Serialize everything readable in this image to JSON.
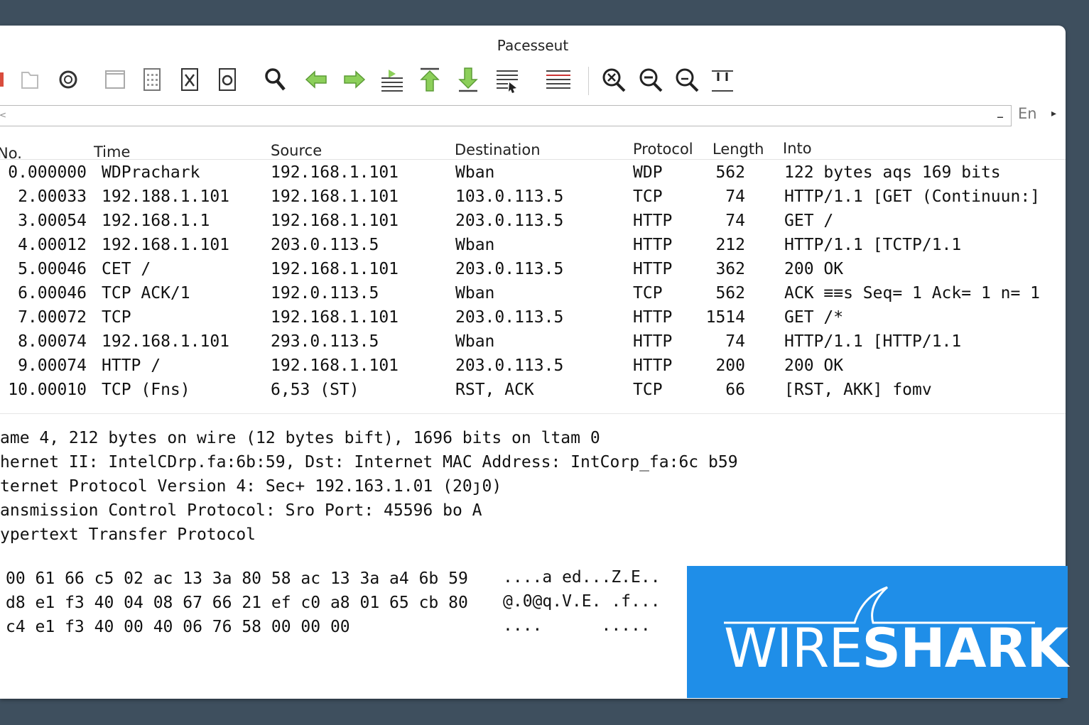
{
  "window": {
    "title": "Pacesseut"
  },
  "toolbar": {
    "icons": [
      "stop-capture-icon",
      "open-file-icon",
      "restart-icon",
      "blank-page-icon",
      "file-set-icon",
      "close-file-icon",
      "reload-icon",
      "find-icon",
      "go-back-icon",
      "go-forward-icon",
      "go-to-packet-icon",
      "go-first-icon",
      "go-last-icon",
      "autoscroll-icon",
      "colorize-icon",
      "zoom-in-icon",
      "zoom-out-icon",
      "normal-size-icon",
      "resize-columns-icon"
    ]
  },
  "filter": {
    "value": "",
    "apply_label": "En",
    "lt_glyph": "<",
    "clear_glyph": "–",
    "more_glyph": "▸"
  },
  "columns": {
    "no": "No.",
    "time": "Time",
    "source": "Source",
    "destination": "Destination",
    "protocol": "Protocol",
    "length": "Length",
    "info": "Into"
  },
  "packets": [
    {
      "no": "0.000000",
      "time": "WDPrachark",
      "source": "192.168.1.101",
      "destination": "Wban",
      "protocol": "WDP",
      "length": "562",
      "info": "122 bytes aqs 169 bits"
    },
    {
      "no": "2.00033",
      "time": "192.188.1.101",
      "source": "192.168.1.101",
      "destination": "103.0.113.5",
      "protocol": "TCP",
      "length": "74",
      "info": "HTTP/1.1 [GET (Continuun:]"
    },
    {
      "no": "3.00054",
      "time": "192.168.1.1",
      "source": "192.168.1.101",
      "destination": "203.0.113.5",
      "protocol": "HTTP",
      "length": "74",
      "info": "GET /"
    },
    {
      "no": "4.00012",
      "time": "192.168.1.101",
      "source": "203.0.113.5",
      "destination": "Wban",
      "protocol": "HTTP",
      "length": "212",
      "info": "HTTP/1.1 [TCTP/1.1"
    },
    {
      "no": "5.00046",
      "time": "CET  /",
      "source": "192.168.1.101",
      "destination": "203.0.113.5",
      "protocol": "HTTP",
      "length": "362",
      "info": "200 OK"
    },
    {
      "no": "6.00046",
      "time": "TCP ACK/1",
      "source": "192.0.113.5",
      "destination": "Wban",
      "protocol": "TCP",
      "length": "562",
      "info": "ACK ≡≡s Seq= 1 Ack= 1 n= 1"
    },
    {
      "no": "7.00072",
      "time": "TCP",
      "source": "192.168.1.101",
      "destination": "203.0.113.5",
      "protocol": "HTTP",
      "length": "1514",
      "info": "GET /*"
    },
    {
      "no": "8.00074",
      "time": "192.168.1.101",
      "source": "293.0.113.5",
      "destination": "Wban",
      "protocol": "HTTP",
      "length": "74",
      "info": "HTTP/1.1 [HTTP/1.1"
    },
    {
      "no": "9.00074",
      "time": "HTTP /",
      "source": "192.168.1.101",
      "destination": "203.0.113.5",
      "protocol": "HTTP",
      "length": "200",
      "info": "200 OK"
    },
    {
      "no": "10.00010",
      "time": "TCP (Fns)",
      "source": "6,53 (ST)",
      "destination": "RST, ACK",
      "protocol": "TCP",
      "length": "66",
      "info": "[RST, AKK] fomv"
    }
  ],
  "details": [
    "ame 4, 212 bytes on wire (12 bytes bift), 1696 bits on ltam 0",
    "hernet II: IntelCDrp.fa:6b:59, Dst: Internet MAC Address: IntCorp_fa:6c b59",
    "ternet Protocol Version 4: Sec+ 192.163.1.01 (20ȷ0)",
    "ansmission Control Protocol: Sro Port: 45596 bo A",
    "ypertext Transfer Protocol"
  ],
  "bytes": {
    "hex": [
      "00 61 66 c5 02 ac 13 3a 80 58 ac 13 3a a4 6b 59",
      "d8 e1 f3 40 04 08 67 66 21 ef c0 a8 01 65 cb 80",
      "c4 e1 f3 40 00 40 06 76 58 00 00 00"
    ],
    "ascii": [
      "....a ed...Z.E..",
      "@.0@q.V.E. .f...",
      "....      ....."
    ]
  },
  "brand": {
    "light": "WIRE",
    "bold": "SHARK",
    "color": "#1f8ee8"
  },
  "colors": {
    "green_arrow": "#7bc043",
    "background": "#3e4f5e"
  }
}
